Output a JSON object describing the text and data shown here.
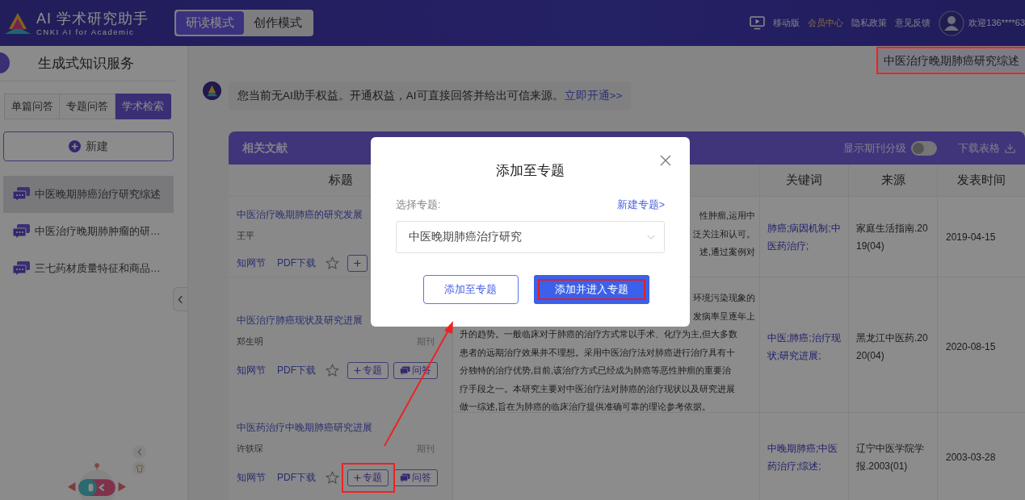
{
  "header": {
    "logo_title": "AI 学术研究助手",
    "logo_subtitle": "CNKI AI for Academic",
    "modes": [
      {
        "label": "研读模式",
        "selected": true
      },
      {
        "label": "创作模式",
        "selected": false
      }
    ],
    "links": [
      {
        "label": "移动版",
        "highlighted": false
      },
      {
        "label": "会员中心",
        "highlighted": true
      },
      {
        "label": "隐私政策",
        "highlighted": false
      },
      {
        "label": "意见反馈",
        "highlighted": false
      }
    ],
    "user_greeting": "欢迎136****63"
  },
  "sidebar": {
    "title": "生成式知识服务",
    "tabs": [
      {
        "label": "单篇问答",
        "selected": false
      },
      {
        "label": "专题问答",
        "selected": false
      },
      {
        "label": "学术检索",
        "selected": true
      }
    ],
    "new_button": "新建",
    "history": [
      {
        "title": "中医晚期肺癌治疗研究综述",
        "selected": true
      },
      {
        "title": "中医治疗晚期肺肿瘤的研…",
        "selected": false
      },
      {
        "title": "三七药材质量特征和商品…",
        "selected": false
      }
    ]
  },
  "main": {
    "topic_chip": {
      "label": "中医治疗晚期肺癌研究综述",
      "annotated": true
    },
    "notice": {
      "text": "您当前无AI助手权益。开通权益，AI可直接回答并给出可信来源。",
      "link": "立即开通>>"
    },
    "literature": {
      "title": "相关文献",
      "grade_toggle": {
        "label": "显示期刊分级",
        "on": false
      },
      "download": "下载表格",
      "columns": [
        "标题",
        "关键词",
        "来源",
        "发表时间"
      ],
      "rows": [
        {
          "title": "中医治疗晚期肺癌的研究发展",
          "author": "王平",
          "node_link": "知网节",
          "pdf_link": "PDF下载",
          "starred": false,
          "topic_annotated": false,
          "abstract_lines": [
            {
              "text": "性肿瘤,运用中",
              "kind": "tail"
            },
            {
              "text": "泛关注和认可。",
              "kind": "tail"
            },
            {
              "text": "述,通过案例对",
              "kind": "tail"
            }
          ],
          "keywords": "肺癌;病因机制;中医药治疗;",
          "source": "家庭生活指南.2019(04)",
          "date": "2019-04-15"
        },
        {
          "title": "中医治疗肺癌现状及研究进展",
          "author": "郑生明",
          "type": "期刊",
          "node_link": "知网节",
          "pdf_link": "PDF下载",
          "starred": false,
          "topic_label": "专题",
          "qa_label": "问答",
          "topic_annotated": false,
          "abstract_lines": [
            {
              "text": "环境污染现象的",
              "kind": "tail"
            },
            {
              "text": "发病率呈逐年上",
              "kind": "tail"
            },
            {
              "text": "升的趋势。一般临床对于肺癌的治疗方式常以手术、化疗为主,但大多数",
              "kind": "full"
            },
            {
              "text": "患者的远期治疗效果并不理想。采用中医治疗法对肺癌进行治疗具有十",
              "kind": "full"
            },
            {
              "text": "分独特的治疗优势,目前,该治疗方式已经成为肺癌等恶性肿瘤的重要治",
              "kind": "full"
            },
            {
              "text": "疗手段之一。本研究主要对中医治疗法对肺癌的治疗现状以及研究进展",
              "kind": "full"
            },
            {
              "text": "做一综述,旨在为肺癌的临床治疗提供准确可靠的理论参考依据。",
              "kind": "full"
            }
          ],
          "keywords": "中医;肺癌;治疗现状;研究进展;",
          "source": "黑龙江中医药.2020(04)",
          "date": "2020-08-15"
        },
        {
          "title": "中医药治疗中晚期肺癌研究进展",
          "author": "许轶琛",
          "type": "期刊",
          "node_link": "知网节",
          "pdf_link": "PDF下载",
          "starred": false,
          "topic_label": "专题",
          "qa_label": "问答",
          "topic_annotated": true,
          "abstract_lines": [],
          "keywords": "中晚期肺癌;中医药治疗;综述;",
          "source": "辽宁中医学院学报.2003(01)",
          "date": "2003-03-28"
        }
      ]
    }
  },
  "modal": {
    "title": "添加至专题",
    "select_label": "选择专题:",
    "new_topic_link": "新建专题>",
    "selected_topic": "中医晚期肺癌治疗研究",
    "secondary_button": "添加至专题",
    "primary_button": {
      "label": "添加并进入专题",
      "annotated": true
    }
  }
}
